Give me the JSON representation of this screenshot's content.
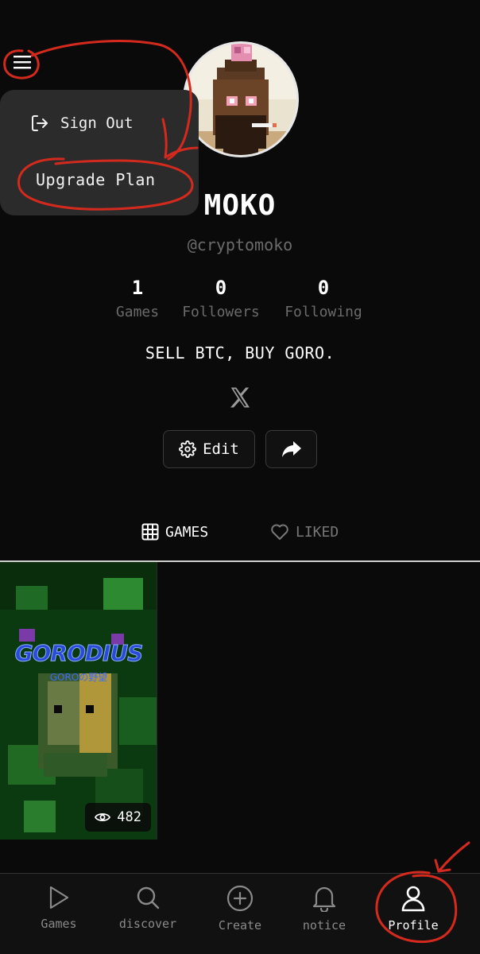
{
  "menu": {
    "items": [
      {
        "label": "Sign Out",
        "icon": "sign-out-icon"
      },
      {
        "label": "Upgrade Plan"
      }
    ]
  },
  "profile": {
    "name": "MOKO",
    "handle": "@cryptomoko",
    "bio": "SELL BTC, BUY GORO.",
    "stats": [
      {
        "value": "1",
        "label": "Games"
      },
      {
        "value": "0",
        "label": "Followers"
      },
      {
        "value": "0",
        "label": "Following"
      }
    ],
    "social_icon": "x-logo-icon"
  },
  "actions": {
    "edit_label": "Edit",
    "edit_icon": "gear-icon",
    "share_icon": "share-icon"
  },
  "tabs": [
    {
      "label": "GAMES",
      "icon": "grid-icon",
      "active": true
    },
    {
      "label": "LIKED",
      "icon": "heart-icon",
      "active": false
    }
  ],
  "games": [
    {
      "title": "GORODIUS",
      "subtitle": "GOROの野望",
      "views": "482"
    }
  ],
  "nav": [
    {
      "label": "Games",
      "icon": "play-icon"
    },
    {
      "label": "discover",
      "icon": "search-icon"
    },
    {
      "label": "Create",
      "icon": "plus-circle-icon"
    },
    {
      "label": "notice",
      "icon": "bell-icon"
    },
    {
      "label": "Profile",
      "icon": "user-icon",
      "active": true
    }
  ],
  "colors": {
    "background": "#0a0a0a",
    "annotation": "#d42a1e",
    "muted_text": "#6b6b6b"
  }
}
